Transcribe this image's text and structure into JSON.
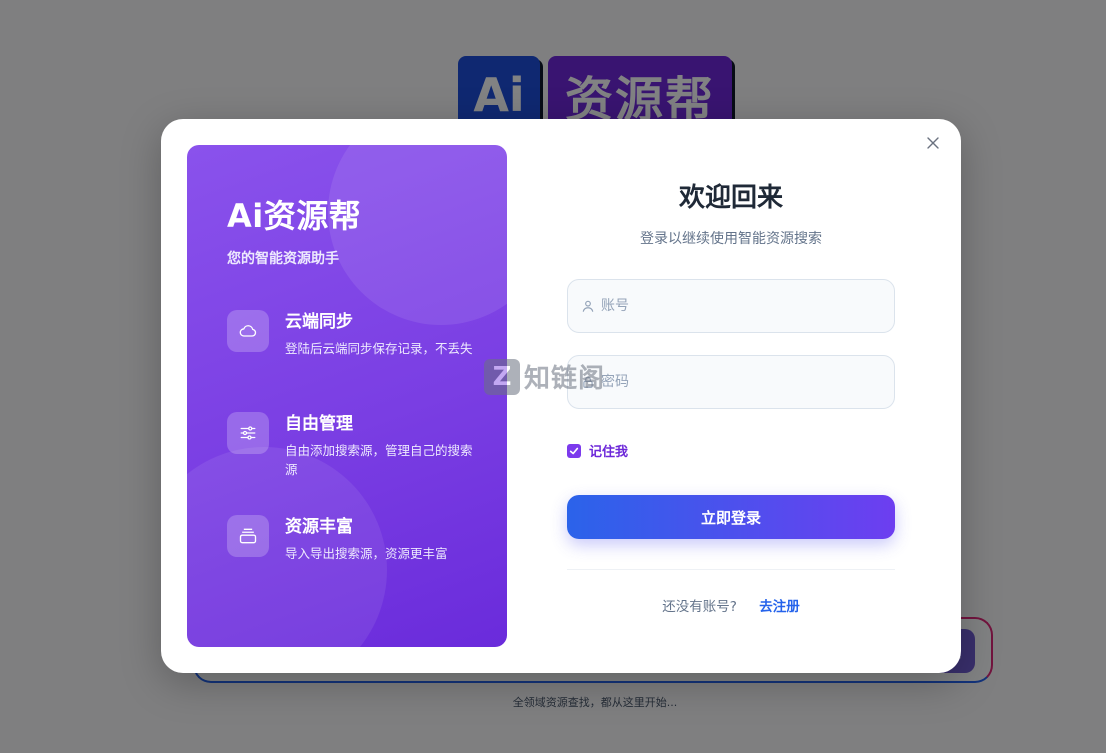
{
  "background": {
    "logo_ai": "Ai",
    "logo_name": "资源帮",
    "search_caption": "全领域资源查找，都从这里开始..."
  },
  "modal": {
    "close_icon": "close-icon",
    "promo": {
      "title": "Ai资源帮",
      "tagline": "您的智能资源助手",
      "features": [
        {
          "icon": "cloud-icon",
          "title": "云端同步",
          "desc": "登陆后云端同步保存记录，不丢失"
        },
        {
          "icon": "sliders-icon",
          "title": "自由管理",
          "desc": "自由添加搜索源，管理自己的搜索源"
        },
        {
          "icon": "layers-icon",
          "title": "资源丰富",
          "desc": "导入导出搜索源，资源更丰富"
        }
      ]
    },
    "form": {
      "title": "欢迎回来",
      "subtitle": "登录以继续使用智能资源搜索",
      "username_placeholder": "账号",
      "password_placeholder": "密码",
      "remember_label": "记住我",
      "remember_checked": true,
      "submit_label": "立即登录",
      "signup_prompt": "还没有账号?",
      "signup_link": "去注册"
    }
  },
  "watermark": {
    "badge": "Z",
    "text": "知链阁"
  },
  "colors": {
    "accent_purple": "#7c3aed",
    "link_blue": "#2563eb",
    "button_gradient_start": "#2b63ea",
    "button_gradient_end": "#6d3ef0"
  }
}
